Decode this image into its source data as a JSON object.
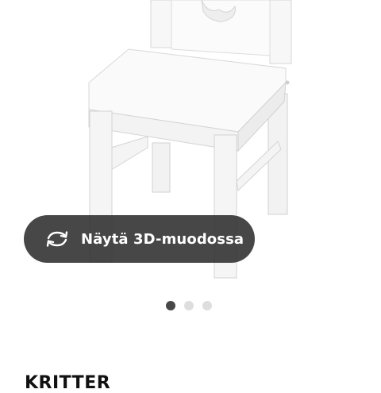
{
  "view_3d": {
    "label": "Näytä 3D-muodossa",
    "icon": "rotate-3d-icon"
  },
  "carousel": {
    "slides": 3,
    "active_index": 0
  },
  "product": {
    "name": "KRITTER"
  },
  "colors": {
    "button_bg": "#2d2d2d",
    "dot_active": "#484848",
    "dot_inactive": "#dedede"
  }
}
